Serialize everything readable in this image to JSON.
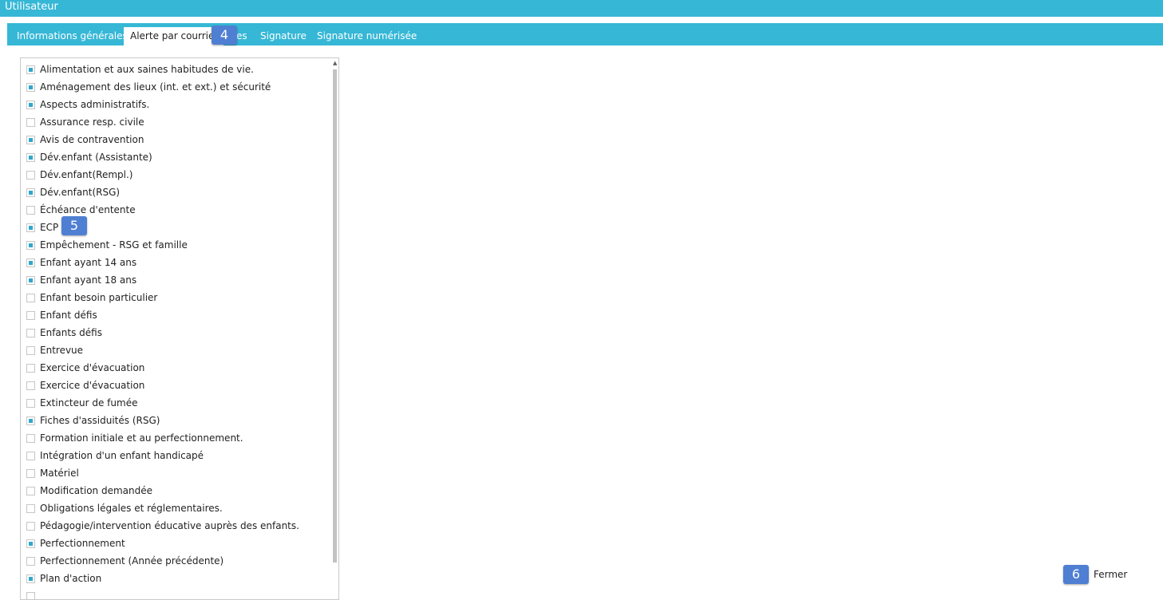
{
  "window": {
    "title": "Utilisateur"
  },
  "tabs": [
    {
      "label": "Informations générales",
      "active": false
    },
    {
      "label": "Alerte par courriel",
      "active": true
    },
    {
      "label": "es",
      "active": false
    },
    {
      "label": "Signature",
      "active": false
    },
    {
      "label": "Signature numérisée",
      "active": false
    }
  ],
  "alerts": [
    {
      "label": "Alimentation et aux saines habitudes de vie.",
      "checked": true
    },
    {
      "label": "Aménagement des lieux (int. et ext.) et sécurité",
      "checked": true
    },
    {
      "label": "Aspects administratifs.",
      "checked": true
    },
    {
      "label": "Assurance resp. civile",
      "checked": false
    },
    {
      "label": "Avis de contravention",
      "checked": true
    },
    {
      "label": "Dév.enfant (Assistante)",
      "checked": true
    },
    {
      "label": "Dév.enfant(Rempl.)",
      "checked": false
    },
    {
      "label": "Dév.enfant(RSG)",
      "checked": true
    },
    {
      "label": "Échéance d'entente",
      "checked": false
    },
    {
      "label": "ECP",
      "checked": true
    },
    {
      "label": "Empêchement - RSG et famille",
      "checked": true
    },
    {
      "label": "Enfant ayant 14 ans",
      "checked": true
    },
    {
      "label": "Enfant ayant 18 ans",
      "checked": true
    },
    {
      "label": "Enfant besoin particulier",
      "checked": false
    },
    {
      "label": "Enfant défis",
      "checked": false
    },
    {
      "label": "Enfants défis",
      "checked": false
    },
    {
      "label": "Entrevue",
      "checked": false
    },
    {
      "label": "Exercice d'évacuation",
      "checked": false
    },
    {
      "label": "Exercice d'évacuation",
      "checked": false
    },
    {
      "label": "Extincteur de fumée",
      "checked": false
    },
    {
      "label": "Fiches d'assiduités (RSG)",
      "checked": true
    },
    {
      "label": "Formation initiale et au perfectionnement.",
      "checked": false
    },
    {
      "label": "Intégration d'un enfant handicapé",
      "checked": false
    },
    {
      "label": "Matériel",
      "checked": false
    },
    {
      "label": "Modification demandée",
      "checked": false
    },
    {
      "label": "Obligations légales et réglementaires.",
      "checked": false
    },
    {
      "label": "Pédagogie/intervention éducative auprès des enfants.",
      "checked": false
    },
    {
      "label": "Perfectionnement",
      "checked": true
    },
    {
      "label": "Perfectionnement (Année précédente)",
      "checked": false
    },
    {
      "label": "Plan d'action",
      "checked": true
    },
    {
      "label": "",
      "checked": false
    }
  ],
  "scrollbar": {
    "up_arrow": "▲"
  },
  "badges": {
    "b4": "4",
    "b5": "5",
    "b6": "6"
  },
  "footer": {
    "close_label": "Fermer"
  },
  "colors": {
    "accent": "#36b7d6",
    "checkbox_fill": "#30a8cb",
    "badge": "#4f7fd3"
  }
}
